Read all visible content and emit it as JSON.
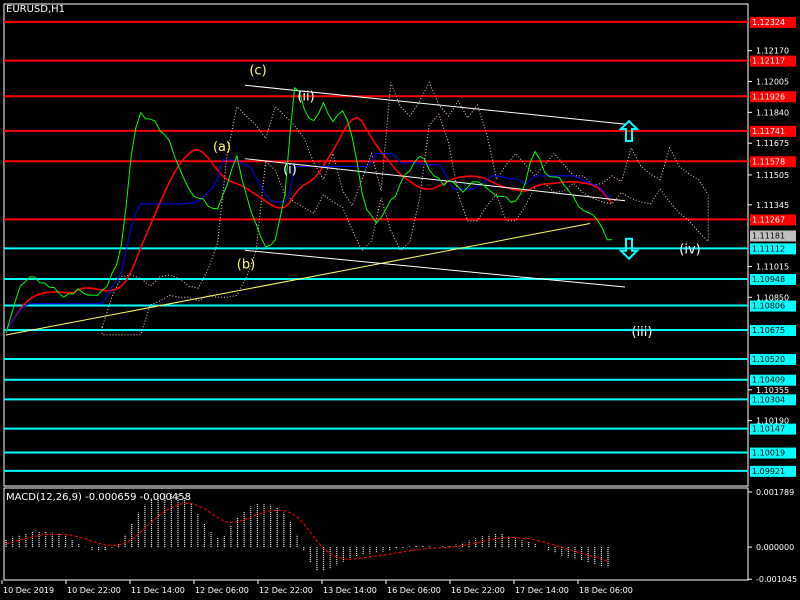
{
  "colors": {
    "background": "#000000",
    "frame": "#ffffff",
    "price_line": "#00ff00",
    "resistance": "#ff0000",
    "support": "#00ffff",
    "ma_red": "#ff0000",
    "ma_blue": "#0000ff",
    "trendline": "#ffff66",
    "channel": "#ffffff",
    "wave_yellow": "#ffff66",
    "wave_white": "#ffffff",
    "macd_hist": "#ffffff",
    "macd_signal": "#ff0000",
    "current_price_bg": "#c0c0c0"
  },
  "chart_data": [
    {
      "type": "line",
      "title": "EURUSD,H1",
      "ylim": [
        1.0984,
        1.1242
      ],
      "x": [
        "10 Dec 2019",
        "10 Dec 22:00",
        "11 Dec 14:00",
        "12 Dec 06:00",
        "12 Dec 22:00",
        "13 Dec 14:00",
        "16 Dec 06:00",
        "16 Dec 22:00",
        "17 Dec 14:00",
        "18 Dec 06:00"
      ],
      "series": [
        {
          "values": [
            1.1067,
            1.1075,
            1.1083,
            1.109,
            1.1094,
            1.1096,
            1.1095,
            1.1094,
            1.1093,
            1.109,
            1.1089,
            1.1088,
            1.1085,
            1.1086,
            1.1088,
            1.109,
            1.1087,
            1.1085,
            1.1087,
            1.1086,
            1.1088,
            1.1092,
            1.1098,
            1.1102,
            1.1112,
            1.1135,
            1.116,
            1.1175,
            1.1185,
            1.1181,
            1.118,
            1.1178,
            1.1175,
            1.1172,
            1.1168,
            1.1162,
            1.1155,
            1.1148,
            1.1142,
            1.114,
            1.1138,
            1.1137,
            1.1135,
            1.1133,
            1.1132,
            1.1138,
            1.1146,
            1.1154,
            1.116,
            1.115,
            1.114,
            1.113,
            1.1123,
            1.1118,
            1.1112,
            1.1112,
            1.1117,
            1.1128,
            1.114,
            1.117,
            1.1198,
            1.1195,
            1.1185,
            1.1182,
            1.118,
            1.1183,
            1.1188,
            1.1184,
            1.1179,
            1.1182,
            1.1186,
            1.118,
            1.117,
            1.1156,
            1.1142,
            1.1132,
            1.1128,
            1.1126,
            1.1128,
            1.1132,
            1.1136,
            1.114,
            1.1146,
            1.115,
            1.1154,
            1.1158,
            1.116,
            1.1158,
            1.1154,
            1.115,
            1.1148,
            1.1146,
            1.1148,
            1.1146,
            1.1143,
            1.1142,
            1.1144,
            1.1146,
            1.1148,
            1.1146,
            1.1143,
            1.114,
            1.114,
            1.1139,
            1.1138,
            1.1137,
            1.1137,
            1.114,
            1.1145,
            1.1158,
            1.1163,
            1.1158,
            1.1153,
            1.115,
            1.1149,
            1.1148,
            1.1146,
            1.1142,
            1.1138,
            1.1135,
            1.1132,
            1.113,
            1.1128,
            1.1127,
            1.1122,
            1.1115,
            1.1117
          ]
        }
      ],
      "resistance_levels": [
        1.12324,
        1.12117,
        1.11926,
        1.11741,
        1.11578,
        1.11267
      ],
      "support_levels": [
        1.11112,
        1.10948,
        1.10806,
        1.10675,
        1.1052,
        1.10409,
        1.10304,
        1.10147,
        1.10019,
        1.09921
      ],
      "axis_ticks": [
        1.1217,
        1.12005,
        1.1184,
        1.11675,
        1.11505,
        1.11345,
        1.11015,
        1.1085,
        1.10355,
        1.1019
      ],
      "current_price": 1.11181,
      "wave_labels": [
        {
          "text": "(c)",
          "color": "yellow",
          "x": "12 Dec 14:00",
          "y": 1.1207
        },
        {
          "text": "(a)",
          "color": "yellow",
          "x": "12 Dec 04:00",
          "y": 1.1166
        },
        {
          "text": "(b)",
          "color": "yellow",
          "x": "12 Dec 11:00",
          "y": 1.1103
        },
        {
          "text": "(ii)",
          "color": "white",
          "x": "13 Dec 00:00",
          "y": 1.1193
        },
        {
          "text": "(i)",
          "color": "white",
          "x": "12 Dec 23:00",
          "y": 1.1154
        },
        {
          "text": "(iv)",
          "color": "white",
          "x": "18 Dec 14:00",
          "y": 1.1111
        },
        {
          "text": "(iii)",
          "color": "white",
          "x": "18 Dec 08:00",
          "y": 1.1067
        }
      ],
      "arrows": [
        {
          "direction": "up",
          "price": 1.1174
        },
        {
          "direction": "down",
          "price": 1.1111
        }
      ]
    },
    {
      "type": "bar",
      "title": "MACD(12,26,9) -0.000659 -0.000458",
      "ylim": [
        -0.00107,
        0.00192
      ],
      "axis_ticks": [
        0.001789,
        0.0,
        -0.001045
      ],
      "axis_tick_labels": [
        "0.001789",
        "0.000000",
        "-0.001045"
      ],
      "series": [
        {
          "name": "MACD",
          "values": [
            0.00025,
            0.00034,
            0.0004,
            0.00045,
            0.00049,
            0.00052,
            0.0005,
            0.00047,
            0.00042,
            0.00036,
            0.00026,
            0.00013,
            1e-05,
            -0.0001,
            -0.00014,
            -0.0001,
            -2e-05,
            0.00012,
            0.0004,
            0.00075,
            0.00112,
            0.00138,
            0.00158,
            0.0017,
            0.00176,
            0.00177,
            0.00172,
            0.0016,
            0.0014,
            0.0011,
            0.00078,
            0.00048,
            0.0003,
            0.00037,
            0.00068,
            0.00095,
            0.00117,
            0.00132,
            0.0014,
            0.00142,
            0.00138,
            0.00128,
            0.00112,
            0.00085,
            0.0004,
            -0.0001,
            -0.0005,
            -0.00075,
            -0.00078,
            -0.00072,
            -0.0006,
            -0.00048,
            -0.00039,
            -0.0003,
            -0.00025,
            -0.00022,
            -0.00018,
            -0.00015,
            -0.0001,
            -6e-05,
            -3e-05,
            2e-05,
            4e-05,
            4e-05,
            2e-05,
            0.0,
            2e-05,
            4e-05,
            8e-05,
            0.00014,
            0.00021,
            0.00028,
            0.00035,
            0.0004,
            0.00045,
            0.00042,
            0.00034,
            0.00028,
            0.00022,
            0.00018,
            0.0001,
            0.0,
            -0.0001,
            -0.0002,
            -0.00028,
            -0.00034,
            -0.0004,
            -0.00045,
            -0.0005,
            -0.00056,
            -0.00062,
            -0.00066
          ]
        },
        {
          "name": "Signal",
          "values": [
            0.0001,
            0.00016,
            0.00022,
            0.00028,
            0.00033,
            0.00038,
            0.00041,
            0.00042,
            0.00042,
            0.00041,
            0.00038,
            0.00033,
            0.00027,
            0.00019,
            0.00012,
            7e-05,
            5e-05,
            6e-05,
            0.00013,
            0.00025,
            0.00042,
            0.00061,
            0.00081,
            0.001,
            0.00116,
            0.00129,
            0.00138,
            0.00142,
            0.00142,
            0.00135,
            0.00124,
            0.0011,
            0.00095,
            0.00083,
            0.0008,
            0.00083,
            0.00089,
            0.00098,
            0.00106,
            0.00113,
            0.00118,
            0.0012,
            0.00118,
            0.00112,
            0.00098,
            0.00075,
            0.00048,
            0.0002,
            -5e-05,
            -0.00022,
            -0.00033,
            -0.00038,
            -0.0004,
            -0.00038,
            -0.00035,
            -0.00032,
            -0.00029,
            -0.00026,
            -0.00023,
            -0.00019,
            -0.00016,
            -0.00012,
            -9e-05,
            -6e-05,
            -4e-05,
            -3e-05,
            -2e-05,
            0.0,
            2e-05,
            5e-05,
            9e-05,
            0.00013,
            0.00018,
            0.00023,
            0.00027,
            0.0003,
            0.00031,
            0.00031,
            0.00029,
            0.00027,
            0.00023,
            0.00018,
            0.00012,
            6e-05,
            0.0,
            -7e-05,
            -0.00014,
            -0.0002,
            -0.00026,
            -0.00032,
            -0.00038,
            -0.00046
          ]
        }
      ]
    }
  ]
}
